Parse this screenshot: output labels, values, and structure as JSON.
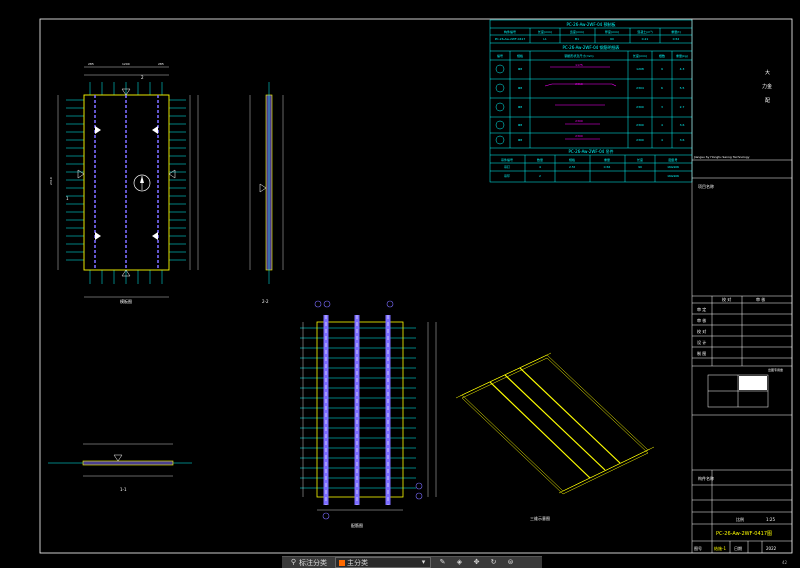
{
  "title_block": {
    "vertical_title": [
      "大",
      "力金",
      "配"
    ],
    "company_note": "Jiangsu Sy Hongtu Sanng Technology",
    "project_label": "项目名称",
    "designer_label": "校 对",
    "reviewer_label": "审 核",
    "rows": [
      "审 定",
      "审 核",
      "校 对",
      "设 计",
      "制 图"
    ],
    "stamp_label": "出图专用章",
    "drawing_name_label": "构件名称",
    "drawing_name": "PC-26-Aw-2WF-0417图",
    "scale_label": "比例",
    "scale_value": "1:25",
    "date_label": "日期",
    "date_value": "2022",
    "sheet_label": "图号",
    "sheet_value": "结施-1",
    "page_number": "42"
  },
  "tables": {
    "t1_title": "PC-26-Aw-2WF-04 预制板",
    "t1_headers": [
      "构件编号",
      "长度(mm)",
      "宽度(mm)",
      "厚度(mm)",
      "混凝土(m³)",
      "重量(t)"
    ],
    "t1_row": [
      "PC-26-Aw-2WF-0417",
      "L1",
      "B1",
      "60",
      "0.21",
      "0.52"
    ],
    "t2_title": "PC-26-Aw-2WF-04 钢筋明细表",
    "t2_headers": [
      "编号",
      "规格",
      "钢筋形状及尺寸(mm)",
      "长度(mm)",
      "根数",
      "重量(kg)"
    ],
    "t2_rows": [
      [
        "1a",
        "Φ8",
        "1175",
        "1208",
        "9",
        "4.3"
      ],
      [
        "2a",
        "Φ8",
        "2310",
        "2304",
        "6",
        "5.5"
      ],
      [
        "3",
        "Φ8",
        "",
        "2300",
        "3",
        "2.7"
      ],
      [
        "4a",
        "Φ8",
        "2300",
        "2300",
        "4",
        "3.6"
      ],
      [
        "5a",
        "Φ8",
        "2300",
        "2300",
        "4",
        "3.6"
      ]
    ],
    "t3_title": "PC-26-Aw-2WF-04 吊件",
    "t3_headers": [
      "吊件编号",
      "数量",
      "规格",
      "重量",
      "长度",
      "图集号"
    ],
    "t3_rows": [
      [
        "吊钉",
        "4",
        "2.5t",
        "0.56",
        "90",
        "16G906"
      ],
      [
        "吊环",
        "2",
        "",
        "",
        "",
        "16G906"
      ]
    ]
  },
  "views": {
    "plan_label": "模板图",
    "section22_label": "2-2",
    "section11_label": "1-1",
    "rebar_label": "配筋图",
    "iso_label": "三维示意图",
    "dim_top": [
      "285",
      "1200",
      "285"
    ],
    "dim_left": "2310",
    "section_mark_1": "1",
    "section_mark_2": "2"
  },
  "toolbar": {
    "measure_label": "标注分类",
    "layer_label": "主分类",
    "layer_dropdown_icon": "chevron-down-icon"
  },
  "colors": {
    "line_white": "#ffffff",
    "line_cyan": "#00ffff",
    "line_yellow": "#ffff00",
    "line_magenta": "#ff00ff",
    "rebar_blue": "#7b6cff"
  }
}
